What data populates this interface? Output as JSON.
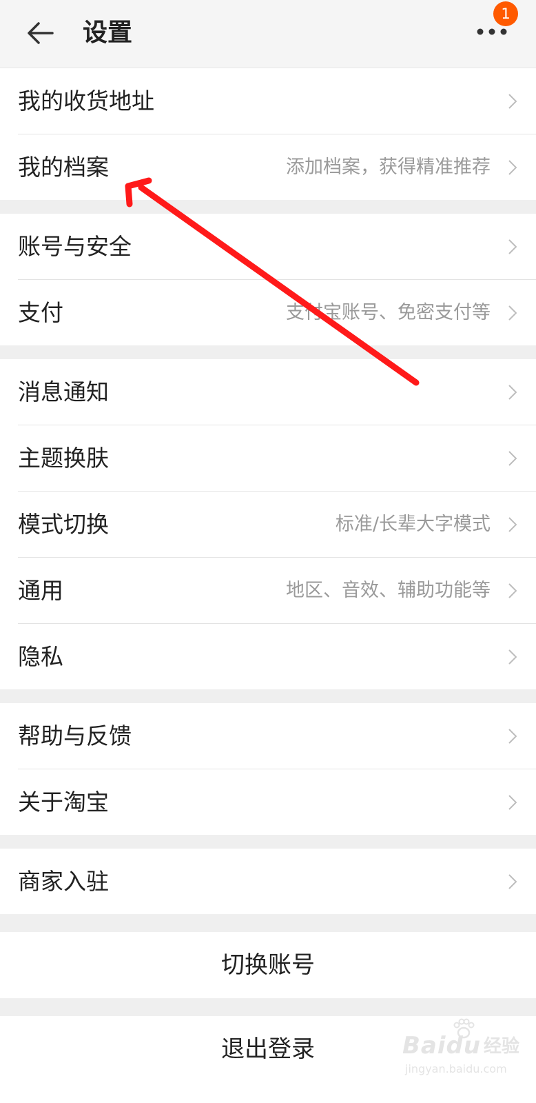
{
  "header": {
    "title": "设置",
    "badge_count": "1"
  },
  "groups": [
    {
      "items": [
        {
          "label": "我的收货地址",
          "hint": ""
        },
        {
          "label": "我的档案",
          "hint": "添加档案，获得精准推荐"
        }
      ]
    },
    {
      "items": [
        {
          "label": "账号与安全",
          "hint": ""
        },
        {
          "label": "支付",
          "hint": "支付宝账号、免密支付等"
        }
      ]
    },
    {
      "items": [
        {
          "label": "消息通知",
          "hint": ""
        },
        {
          "label": "主题换肤",
          "hint": ""
        },
        {
          "label": "模式切换",
          "hint": "标准/长辈大字模式"
        },
        {
          "label": "通用",
          "hint": "地区、音效、辅助功能等"
        },
        {
          "label": "隐私",
          "hint": ""
        }
      ]
    },
    {
      "items": [
        {
          "label": "帮助与反馈",
          "hint": ""
        },
        {
          "label": "关于淘宝",
          "hint": ""
        }
      ]
    },
    {
      "items": [
        {
          "label": "商家入驻",
          "hint": ""
        }
      ]
    }
  ],
  "actions": {
    "switch_account": "切换账号",
    "logout": "退出登录"
  },
  "watermark": {
    "brand": "Baidu",
    "brand_cn": "经验",
    "url": "jingyan.baidu.com"
  },
  "colors": {
    "badge": "#ff5a00",
    "annotation_arrow": "#ff1a1a",
    "hint_text": "#9a9a9a",
    "section_gap": "#efefef"
  },
  "icons": {
    "back": "back-arrow-icon",
    "more": "more-dots-icon",
    "chevron": "chevron-right-icon"
  }
}
